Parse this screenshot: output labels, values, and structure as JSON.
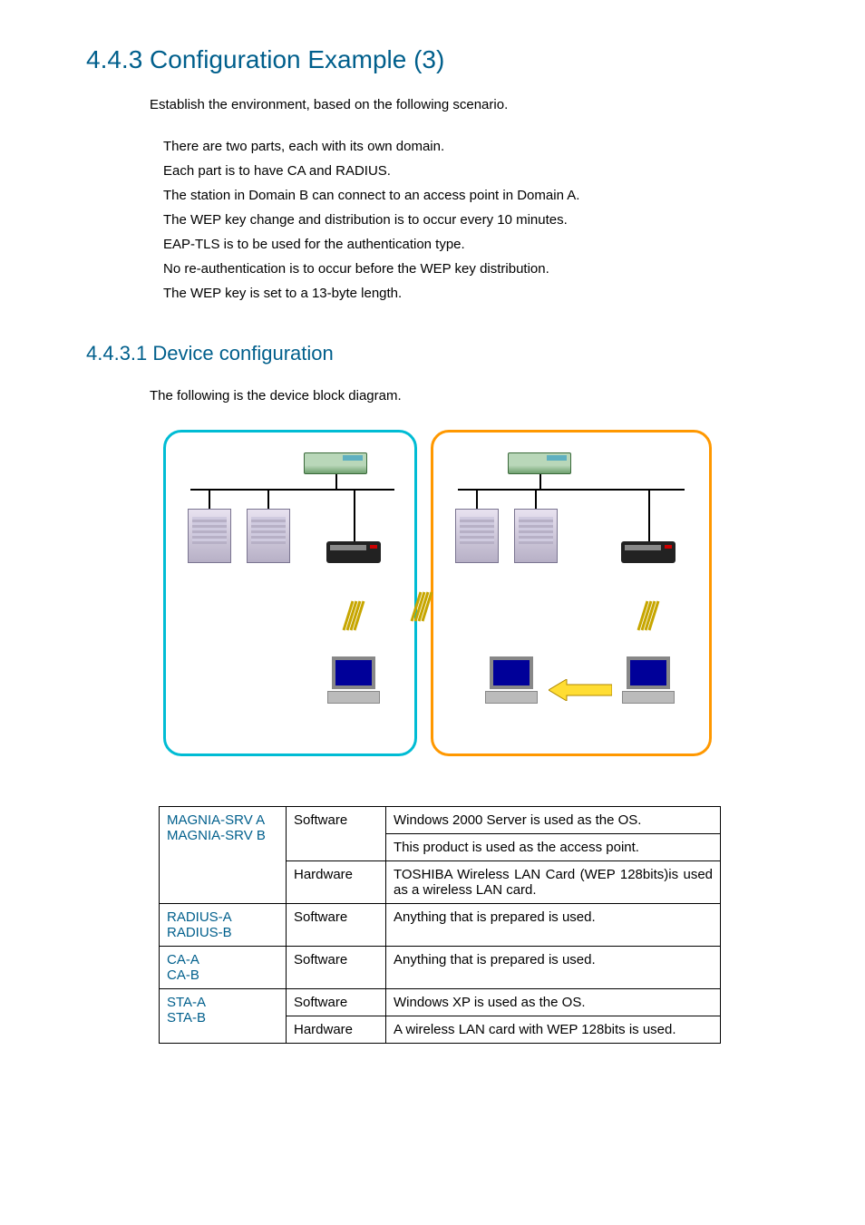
{
  "headings": {
    "section": "4.4.3  Configuration Example (3)",
    "subsection": "4.4.3.1 Device configuration"
  },
  "intro": "Establish the environment, based on the following scenario.",
  "scenario": [
    "There are two parts, each with its own domain.",
    "Each part is to have CA and RADIUS.",
    "The station in Domain B can connect to an access point in Domain A.",
    "The WEP key change and distribution is to occur every 10 minutes.",
    "EAP-TLS is to be used for the authentication type.",
    "No re-authentication is to occur before the WEP key distribution.",
    "The WEP key is set to a 13-byte length."
  ],
  "diag_intro": "The following is the device block diagram.",
  "table": {
    "rows": [
      {
        "devices": [
          "MAGNIA-SRV A",
          "MAGNIA-SRV B"
        ],
        "cells": [
          [
            "Software",
            "Windows 2000 Server is used as the OS."
          ],
          [
            "",
            "This product is used as the access point."
          ],
          [
            "Hardware",
            "TOSHIBA Wireless LAN Card (WEP 128bits)is used as a wireless LAN card."
          ]
        ]
      },
      {
        "devices": [
          "RADIUS-A",
          "RADIUS-B"
        ],
        "cells": [
          [
            "Software",
            "Anything that is prepared is used."
          ]
        ]
      },
      {
        "devices": [
          "CA-A",
          "CA-B"
        ],
        "cells": [
          [
            "Software",
            "Anything that is prepared is used."
          ]
        ]
      },
      {
        "devices": [
          "STA-A",
          "STA-B"
        ],
        "cells": [
          [
            "Software",
            "Windows XP is used as the OS."
          ],
          [
            "Hardware",
            "A wireless LAN card with WEP 128bits is used."
          ]
        ]
      }
    ]
  }
}
